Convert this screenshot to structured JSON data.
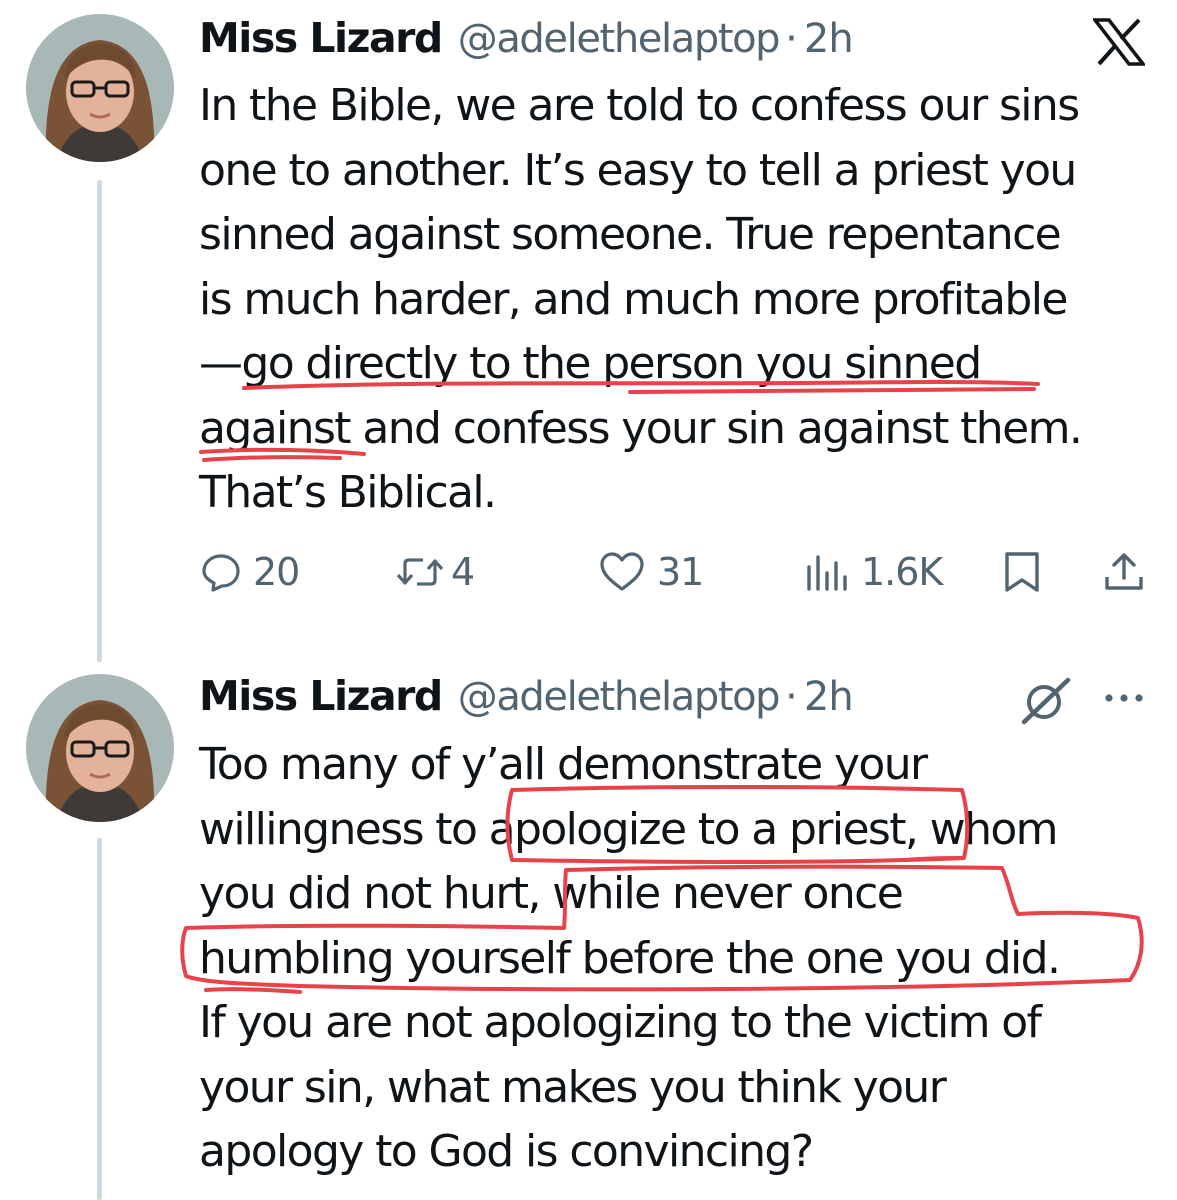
{
  "tweets": [
    {
      "display_name": "Miss Lizard",
      "handle": "@adelethelaptop",
      "separator": "·",
      "time": "2h",
      "avatar_icon": "user-avatar",
      "body_lines": [
        "In the Bible, we are told to confess our sins",
        "one to another. It’s easy to tell a priest you",
        "sinned against someone. True repentance",
        "is much harder, and much more profitable",
        "—go directly to the person you sinned",
        "against and confess your sin against them.",
        "That’s Biblical."
      ],
      "actions": {
        "replies": "20",
        "reposts": "4",
        "likes": "31",
        "views": "1.6K"
      },
      "corner_icon": "x-logo-icon"
    },
    {
      "display_name": "Miss Lizard",
      "handle": "@adelethelaptop",
      "separator": "·",
      "time": "2h",
      "avatar_icon": "user-avatar",
      "body_lines": [
        "Too many of y’all demonstrate your",
        "willingness to apologize to a priest, whom",
        "you did not hurt, while never once",
        "humbling yourself before the one you did.",
        "If you are not apologizing to the victim of",
        "your sin, what makes you think your",
        "apology to God is convincing?"
      ],
      "corner_icons": [
        "grok-icon",
        "more-icon"
      ]
    }
  ],
  "colors": {
    "text": "#0f1419",
    "secondary": "#536471",
    "thread_line": "#cfd9de",
    "annotation": "#e8434b"
  }
}
